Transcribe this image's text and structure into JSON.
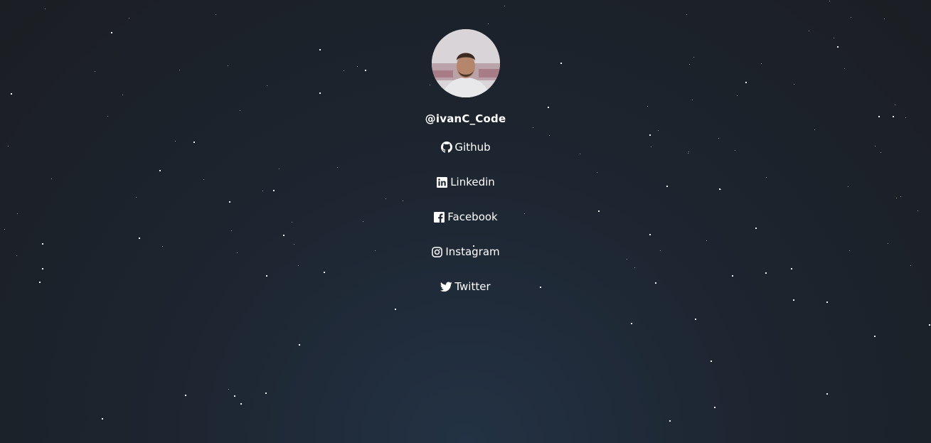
{
  "profile": {
    "avatar_alt": "profile photo",
    "username": "@ivanC_Code"
  },
  "links": [
    {
      "label": "Github",
      "icon": "github-icon"
    },
    {
      "label": "Linkedin",
      "icon": "linkedin-icon"
    },
    {
      "label": "Facebook",
      "icon": "facebook-icon"
    },
    {
      "label": "Instagram",
      "icon": "instagram-icon"
    },
    {
      "label": "Twitter",
      "icon": "twitter-icon"
    }
  ],
  "colors": {
    "background_center": "#233244",
    "background_edge": "#1b1e23",
    "text": "#ffffff",
    "stars": "#ffffff"
  }
}
